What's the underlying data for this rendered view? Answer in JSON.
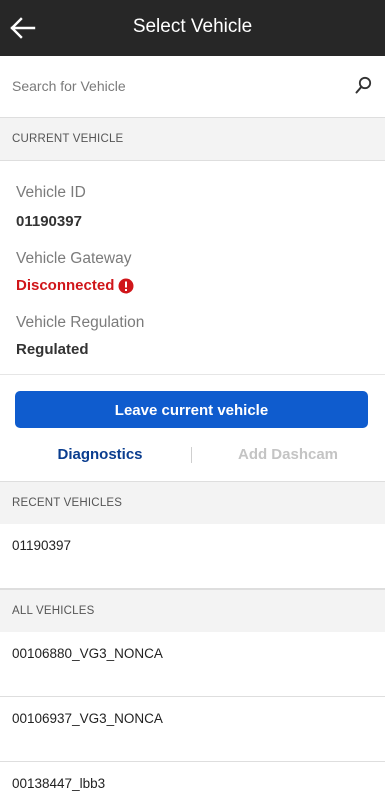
{
  "header": {
    "title": "Select Vehicle",
    "back_icon": "arrow-left-icon"
  },
  "search": {
    "placeholder": "Search for Vehicle",
    "icon": "search-icon"
  },
  "current_vehicle": {
    "section_title": "CURRENT VEHICLE",
    "vehicle_id_label": "Vehicle ID",
    "vehicle_id_value": "01190397",
    "gateway_label": "Vehicle Gateway",
    "gateway_value": "Disconnected",
    "gateway_status_color": "#d0161a",
    "regulation_label": "Vehicle Regulation",
    "regulation_value": "Regulated"
  },
  "actions": {
    "leave_label": "Leave current vehicle",
    "diagnostics_label": "Diagnostics",
    "add_dashcam_label": "Add Dashcam",
    "primary_color": "#0f5cce"
  },
  "recent_vehicles": {
    "section_title": "RECENT VEHICLES",
    "items": [
      "01190397"
    ]
  },
  "all_vehicles": {
    "section_title": "ALL VEHICLES",
    "items": [
      "00106880_VG3_NONCA",
      "00106937_VG3_NONCA",
      "00138447_lbb3"
    ]
  }
}
